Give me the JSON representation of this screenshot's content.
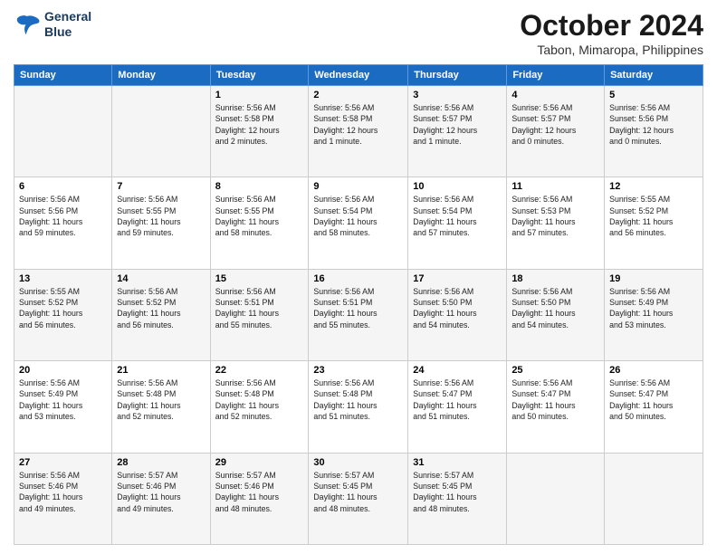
{
  "logo": {
    "line1": "General",
    "line2": "Blue"
  },
  "header": {
    "month": "October 2024",
    "location": "Tabon, Mimaropa, Philippines"
  },
  "days_of_week": [
    "Sunday",
    "Monday",
    "Tuesday",
    "Wednesday",
    "Thursday",
    "Friday",
    "Saturday"
  ],
  "weeks": [
    [
      {
        "day": "",
        "info": ""
      },
      {
        "day": "",
        "info": ""
      },
      {
        "day": "1",
        "info": "Sunrise: 5:56 AM\nSunset: 5:58 PM\nDaylight: 12 hours\nand 2 minutes."
      },
      {
        "day": "2",
        "info": "Sunrise: 5:56 AM\nSunset: 5:58 PM\nDaylight: 12 hours\nand 1 minute."
      },
      {
        "day": "3",
        "info": "Sunrise: 5:56 AM\nSunset: 5:57 PM\nDaylight: 12 hours\nand 1 minute."
      },
      {
        "day": "4",
        "info": "Sunrise: 5:56 AM\nSunset: 5:57 PM\nDaylight: 12 hours\nand 0 minutes."
      },
      {
        "day": "5",
        "info": "Sunrise: 5:56 AM\nSunset: 5:56 PM\nDaylight: 12 hours\nand 0 minutes."
      }
    ],
    [
      {
        "day": "6",
        "info": "Sunrise: 5:56 AM\nSunset: 5:56 PM\nDaylight: 11 hours\nand 59 minutes."
      },
      {
        "day": "7",
        "info": "Sunrise: 5:56 AM\nSunset: 5:55 PM\nDaylight: 11 hours\nand 59 minutes."
      },
      {
        "day": "8",
        "info": "Sunrise: 5:56 AM\nSunset: 5:55 PM\nDaylight: 11 hours\nand 58 minutes."
      },
      {
        "day": "9",
        "info": "Sunrise: 5:56 AM\nSunset: 5:54 PM\nDaylight: 11 hours\nand 58 minutes."
      },
      {
        "day": "10",
        "info": "Sunrise: 5:56 AM\nSunset: 5:54 PM\nDaylight: 11 hours\nand 57 minutes."
      },
      {
        "day": "11",
        "info": "Sunrise: 5:56 AM\nSunset: 5:53 PM\nDaylight: 11 hours\nand 57 minutes."
      },
      {
        "day": "12",
        "info": "Sunrise: 5:55 AM\nSunset: 5:52 PM\nDaylight: 11 hours\nand 56 minutes."
      }
    ],
    [
      {
        "day": "13",
        "info": "Sunrise: 5:55 AM\nSunset: 5:52 PM\nDaylight: 11 hours\nand 56 minutes."
      },
      {
        "day": "14",
        "info": "Sunrise: 5:56 AM\nSunset: 5:52 PM\nDaylight: 11 hours\nand 56 minutes."
      },
      {
        "day": "15",
        "info": "Sunrise: 5:56 AM\nSunset: 5:51 PM\nDaylight: 11 hours\nand 55 minutes."
      },
      {
        "day": "16",
        "info": "Sunrise: 5:56 AM\nSunset: 5:51 PM\nDaylight: 11 hours\nand 55 minutes."
      },
      {
        "day": "17",
        "info": "Sunrise: 5:56 AM\nSunset: 5:50 PM\nDaylight: 11 hours\nand 54 minutes."
      },
      {
        "day": "18",
        "info": "Sunrise: 5:56 AM\nSunset: 5:50 PM\nDaylight: 11 hours\nand 54 minutes."
      },
      {
        "day": "19",
        "info": "Sunrise: 5:56 AM\nSunset: 5:49 PM\nDaylight: 11 hours\nand 53 minutes."
      }
    ],
    [
      {
        "day": "20",
        "info": "Sunrise: 5:56 AM\nSunset: 5:49 PM\nDaylight: 11 hours\nand 53 minutes."
      },
      {
        "day": "21",
        "info": "Sunrise: 5:56 AM\nSunset: 5:48 PM\nDaylight: 11 hours\nand 52 minutes."
      },
      {
        "day": "22",
        "info": "Sunrise: 5:56 AM\nSunset: 5:48 PM\nDaylight: 11 hours\nand 52 minutes."
      },
      {
        "day": "23",
        "info": "Sunrise: 5:56 AM\nSunset: 5:48 PM\nDaylight: 11 hours\nand 51 minutes."
      },
      {
        "day": "24",
        "info": "Sunrise: 5:56 AM\nSunset: 5:47 PM\nDaylight: 11 hours\nand 51 minutes."
      },
      {
        "day": "25",
        "info": "Sunrise: 5:56 AM\nSunset: 5:47 PM\nDaylight: 11 hours\nand 50 minutes."
      },
      {
        "day": "26",
        "info": "Sunrise: 5:56 AM\nSunset: 5:47 PM\nDaylight: 11 hours\nand 50 minutes."
      }
    ],
    [
      {
        "day": "27",
        "info": "Sunrise: 5:56 AM\nSunset: 5:46 PM\nDaylight: 11 hours\nand 49 minutes."
      },
      {
        "day": "28",
        "info": "Sunrise: 5:57 AM\nSunset: 5:46 PM\nDaylight: 11 hours\nand 49 minutes."
      },
      {
        "day": "29",
        "info": "Sunrise: 5:57 AM\nSunset: 5:46 PM\nDaylight: 11 hours\nand 48 minutes."
      },
      {
        "day": "30",
        "info": "Sunrise: 5:57 AM\nSunset: 5:45 PM\nDaylight: 11 hours\nand 48 minutes."
      },
      {
        "day": "31",
        "info": "Sunrise: 5:57 AM\nSunset: 5:45 PM\nDaylight: 11 hours\nand 48 minutes."
      },
      {
        "day": "",
        "info": ""
      },
      {
        "day": "",
        "info": ""
      }
    ]
  ]
}
